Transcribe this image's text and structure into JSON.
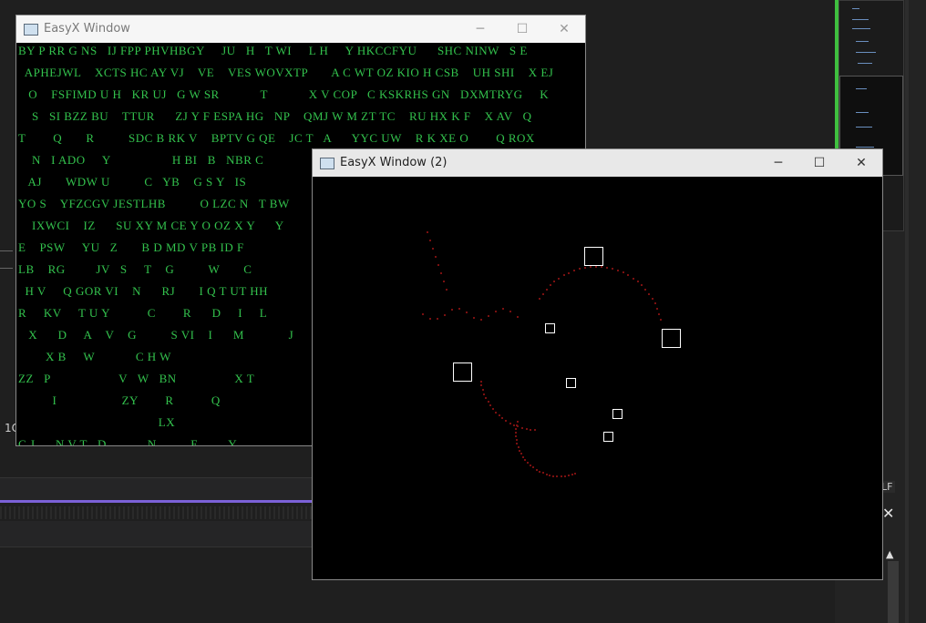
{
  "ide": {
    "line_number": "1C",
    "lf_label": "LF",
    "close": "✕",
    "scroll_up": "▲"
  },
  "window1": {
    "title": "EasyX Window",
    "matrix_lines": [
      "BY P RR G NS   IJ FPP PHVHBGY     JU   H   T WI     L H     Y HKCCFYU      SHC NINW   S E",
      "  APHEJWL    XCTS HC AY VJ    VE    VES WOVXTP       A C WT OZ KIO H CSB    UH SHI    X EJ",
      "   O    FSFIMD U H   KR UJ   G W SR            T            X V COP   C KSKRHS GN   DXMTRYG     K",
      "    S   SI BZZ BU    TTUR      ZJ Y F ESPA HG   NP    QMJ W M ZT TC    RU HX K F    X AV   Q",
      "T        Q       R          SDC B RK V    BPTV G QE    JC T   A      YYC UW    R K XE O        Q ROX",
      "    N   I ADO     Y                  H BI   B   NBR C",
      "   AJ       WDW U          C   YB    G S Y   IS",
      "YO S    YFZCGV JESTLHB          O LZC N   T BW",
      "    IXWCI    IZ      SU XY M CE Y O OZ X Y      Y",
      "E    PSW     YU   Z       B D MD V PB ID F",
      "LB    RG         JV   S     T    G          W       C",
      "  H V     Q GOR VI    N      RJ       I Q T UT HH",
      "R     KV     T U Y           C        R      D     I     L",
      "   X      D     A    V    G          S VI    I      M             J",
      "        X B     W            C H W",
      "ZZ   P                    V   W   BN                 X T",
      "          I                   ZY        R           Q",
      "                                         LX",
      "C J      N V T   D            N          F         Y"
    ]
  },
  "window2": {
    "title": "EasyX Window (2)"
  },
  "controls": {
    "minimize": "─",
    "maximize": "☐",
    "close": "✕"
  }
}
